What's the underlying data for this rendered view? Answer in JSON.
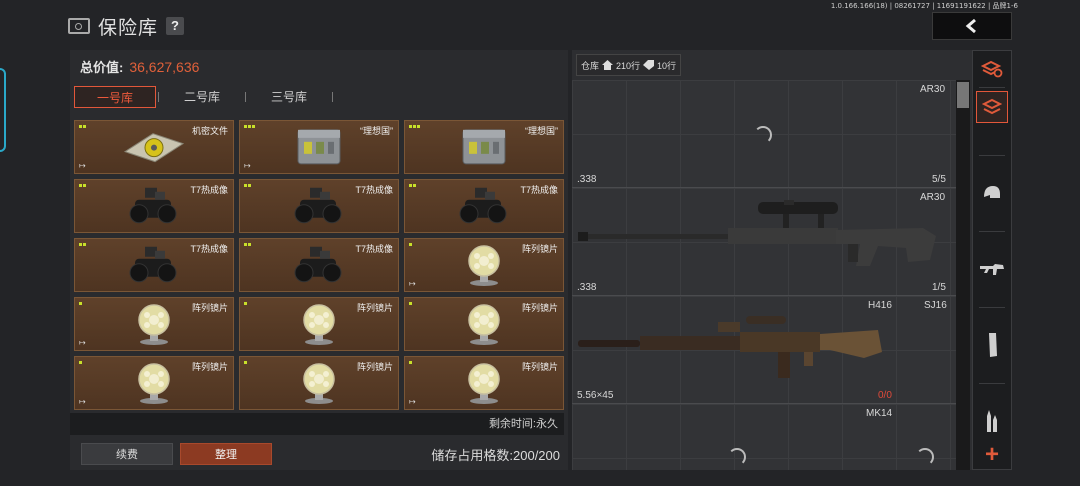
{
  "app": {
    "version": "1.0.166.166(18) | 08261727 | 11691191622 | 品牌1-6",
    "title": "保险库",
    "help_label": "?"
  },
  "vault": {
    "total_label": "总价值:",
    "total_value": "36,627,636",
    "tabs": [
      {
        "label": "一号库",
        "active": true
      },
      {
        "label": "二号库",
        "active": false
      },
      {
        "label": "三号库",
        "active": false
      }
    ],
    "items": [
      {
        "label": "机密文件",
        "dots": 2,
        "exit": true,
        "icon": "classified-file-icon"
      },
      {
        "label": "“理想国”",
        "dots": 3,
        "exit": true,
        "icon": "supply-crate-icon"
      },
      {
        "label": "“理想国”",
        "dots": 3,
        "exit": false,
        "icon": "supply-crate-icon"
      },
      {
        "label": "T7热成像",
        "dots": 2,
        "exit": false,
        "icon": "thermal-scope-icon"
      },
      {
        "label": "T7热成像",
        "dots": 2,
        "exit": false,
        "icon": "thermal-scope-icon"
      },
      {
        "label": "T7热成像",
        "dots": 2,
        "exit": false,
        "icon": "thermal-scope-icon"
      },
      {
        "label": "T7热成像",
        "dots": 2,
        "exit": false,
        "icon": "thermal-scope-icon"
      },
      {
        "label": "T7热成像",
        "dots": 2,
        "exit": false,
        "icon": "thermal-scope-icon"
      },
      {
        "label": "阵列镜片",
        "dots": 1,
        "exit": true,
        "icon": "array-lens-icon"
      },
      {
        "label": "阵列镜片",
        "dots": 1,
        "exit": true,
        "icon": "array-lens-icon"
      },
      {
        "label": "阵列镜片",
        "dots": 1,
        "exit": false,
        "icon": "array-lens-icon"
      },
      {
        "label": "阵列镜片",
        "dots": 1,
        "exit": false,
        "icon": "array-lens-icon"
      },
      {
        "label": "阵列镜片",
        "dots": 1,
        "exit": true,
        "icon": "array-lens-icon"
      },
      {
        "label": "阵列镜片",
        "dots": 1,
        "exit": false,
        "icon": "array-lens-icon"
      },
      {
        "label": "阵列镜片",
        "dots": 1,
        "exit": true,
        "icon": "array-lens-icon"
      }
    ],
    "remaining_text": "剩余时间:永久",
    "renew_label": "续费",
    "sort_label": "整理",
    "storage_text": "储存占用格数:200/200"
  },
  "warehouse": {
    "label": "仓库",
    "rows_a": "210行",
    "rows_b": "10行",
    "weapons": [
      {
        "name": "AR30",
        "caliber": ".338",
        "count": "5/5"
      },
      {
        "name": "AR30",
        "caliber": ".338",
        "count": "1/5"
      },
      {
        "name": "H416",
        "caliber": "5.56×45",
        "count": "0/0"
      },
      {
        "name": "SJ16"
      },
      {
        "name": "MK14"
      }
    ]
  },
  "colors": {
    "accent": "#e2573a",
    "value": "#e0603a",
    "item_bg": "#5c3f28",
    "rarity_dot": "#c8e02a"
  }
}
